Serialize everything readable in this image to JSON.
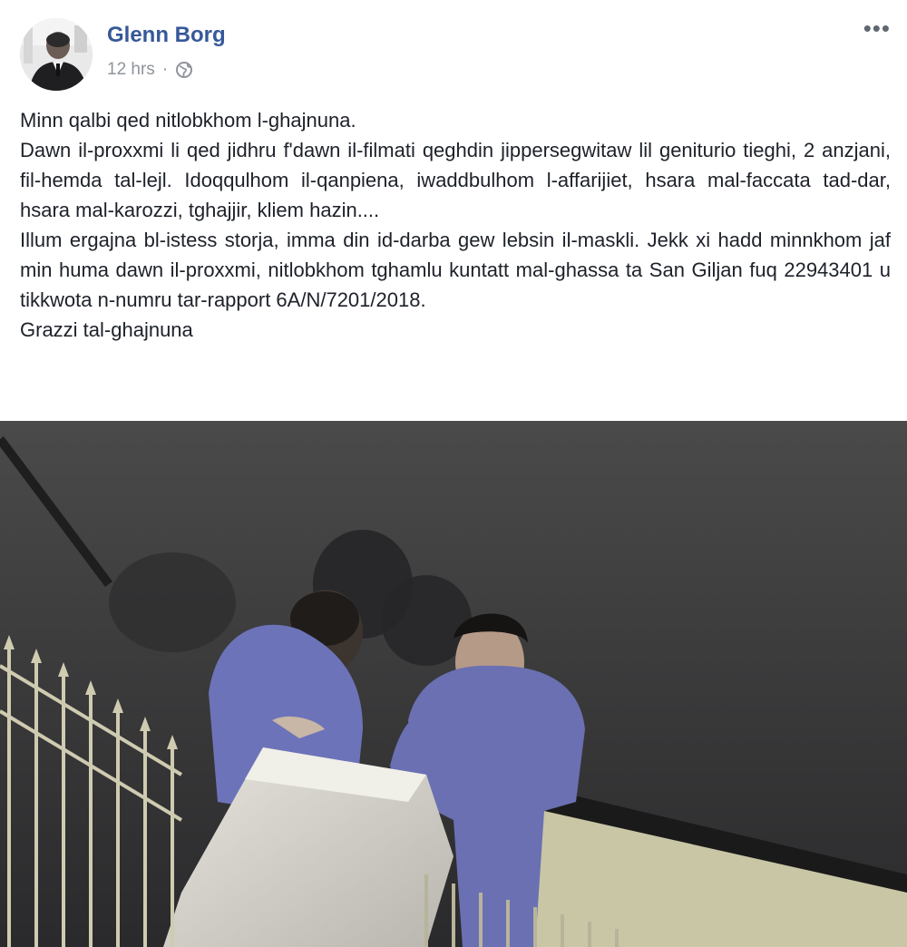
{
  "post": {
    "author": "Glenn Borg",
    "timestamp": "12 hrs",
    "separator": "·",
    "privacy_icon": "globe-icon",
    "more_icon": "more-options-icon",
    "more_label": "•••",
    "text_lines": [
      "Minn qalbi qed nitlobkhom l-ghajnuna.",
      "Dawn il-proxxmi li qed jidhru f'dawn il-filmati qeghdin jippersegwitaw lil geniturio tieghi, 2 anzjani, fil-hemda tal-lejl. Idoqqulhom il-qanpiena, iwaddbulhom l-affarijiet, hsara mal-faccata tad-dar, hsara mal-karozzi, tghajjir, kliem hazin....",
      "Illum ergajna bl-istess storja, imma din id-darba gew lebsin il-maskli. Jekk xi hadd minnkhom jaf min huma dawn il-proxxmi, nitlobkhom tghamlu kuntatt mal-ghassa ta San Giljan fuq 22943401 u tikkwota n-numru tar-rapport 6A/N/7201/2018.",
      "Grazzi tal-ghajnuna"
    ],
    "colors": {
      "author": "#365899",
      "meta": "#90949c",
      "text": "#1d2129"
    }
  }
}
